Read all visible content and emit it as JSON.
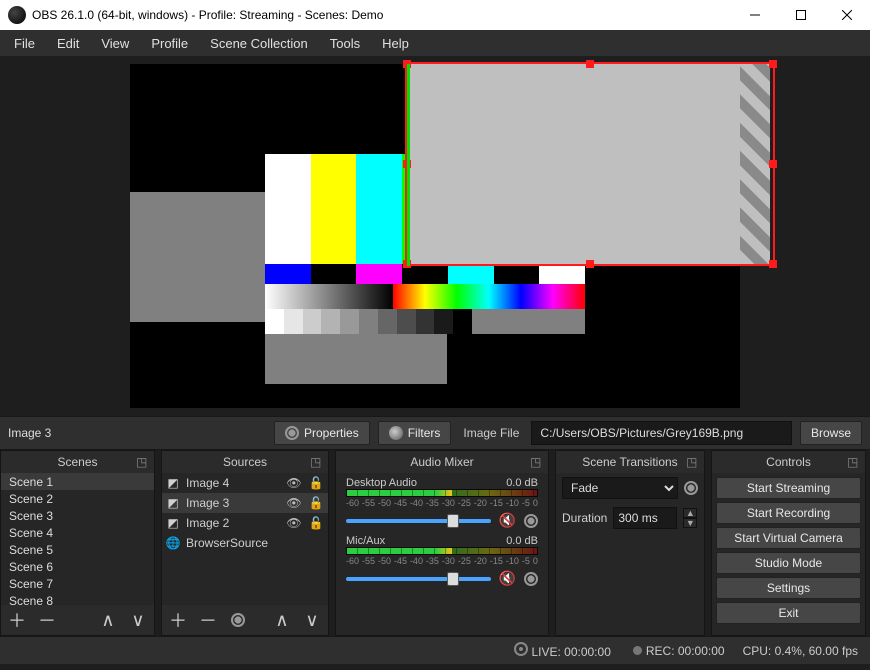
{
  "window": {
    "title": "OBS 26.1.0 (64-bit, windows) - Profile: Streaming - Scenes: Demo"
  },
  "menu": [
    "File",
    "Edit",
    "View",
    "Profile",
    "Scene Collection",
    "Tools",
    "Help"
  ],
  "context": {
    "selected_source": "Image 3",
    "properties_label": "Properties",
    "filters_label": "Filters",
    "field_label": "Image File",
    "field_value": "C:/Users/OBS/Pictures/Grey169B.png",
    "browse_label": "Browse"
  },
  "scenes_panel": {
    "title": "Scenes",
    "items": [
      "Scene 1",
      "Scene 2",
      "Scene 3",
      "Scene 4",
      "Scene 5",
      "Scene 6",
      "Scene 7",
      "Scene 8"
    ],
    "active_index": 0
  },
  "sources_panel": {
    "title": "Sources",
    "items": [
      {
        "name": "Image 4",
        "icon": "image-icon",
        "visible": true,
        "locked": false
      },
      {
        "name": "Image 3",
        "icon": "image-icon",
        "visible": true,
        "locked": false
      },
      {
        "name": "Image 2",
        "icon": "image-icon",
        "visible": true,
        "locked": false
      },
      {
        "name": "BrowserSource",
        "icon": "globe-icon",
        "visible": true,
        "locked": false
      }
    ],
    "active_index": 1
  },
  "mixer_panel": {
    "title": "Audio Mixer",
    "tick_labels": [
      "-60",
      "-55",
      "-50",
      "-45",
      "-40",
      "-35",
      "-30",
      "-25",
      "-20",
      "-15",
      "-10",
      "-5",
      "0"
    ],
    "channels": [
      {
        "name": "Desktop Audio",
        "level": "0.0 dB",
        "muted": true
      },
      {
        "name": "Mic/Aux",
        "level": "0.0 dB",
        "muted": true
      }
    ]
  },
  "transitions_panel": {
    "title": "Scene Transitions",
    "selected": "Fade",
    "duration_label": "Duration",
    "duration_value": "300 ms"
  },
  "controls_panel": {
    "title": "Controls",
    "buttons": [
      "Start Streaming",
      "Start Recording",
      "Start Virtual Camera",
      "Studio Mode",
      "Settings",
      "Exit"
    ]
  },
  "status": {
    "live": "LIVE: 00:00:00",
    "rec": "REC: 00:00:00",
    "cpu": "CPU: 0.4%, 60.00 fps"
  }
}
